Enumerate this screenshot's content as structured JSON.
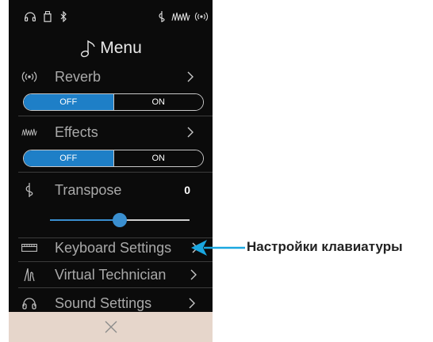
{
  "menu": {
    "title": "Menu"
  },
  "status_icons": [
    "headphones-icon",
    "usb-icon",
    "bluetooth-icon",
    "transpose-icon",
    "effects-icon",
    "reverb-icon"
  ],
  "reverb": {
    "label": "Reverb",
    "off_label": "OFF",
    "on_label": "ON",
    "state": "OFF"
  },
  "effects": {
    "label": "Effects",
    "off_label": "OFF",
    "on_label": "ON",
    "state": "OFF"
  },
  "transpose": {
    "label": "Transpose",
    "value": "0",
    "slider_fraction": 0.5
  },
  "items": [
    {
      "label": "Keyboard Settings",
      "icon": "keyboard-icon"
    },
    {
      "label": "Virtual Technician",
      "icon": "technician-icon"
    },
    {
      "label": "Sound Settings",
      "icon": "headphones-icon"
    }
  ],
  "footer": {
    "close_icon": "close-icon"
  },
  "annotation": {
    "text": "Настройки клавиатуры"
  },
  "colors": {
    "background": "#0b0b0b",
    "accent": "#1e7fc7",
    "footer": "#e6d6cb"
  }
}
